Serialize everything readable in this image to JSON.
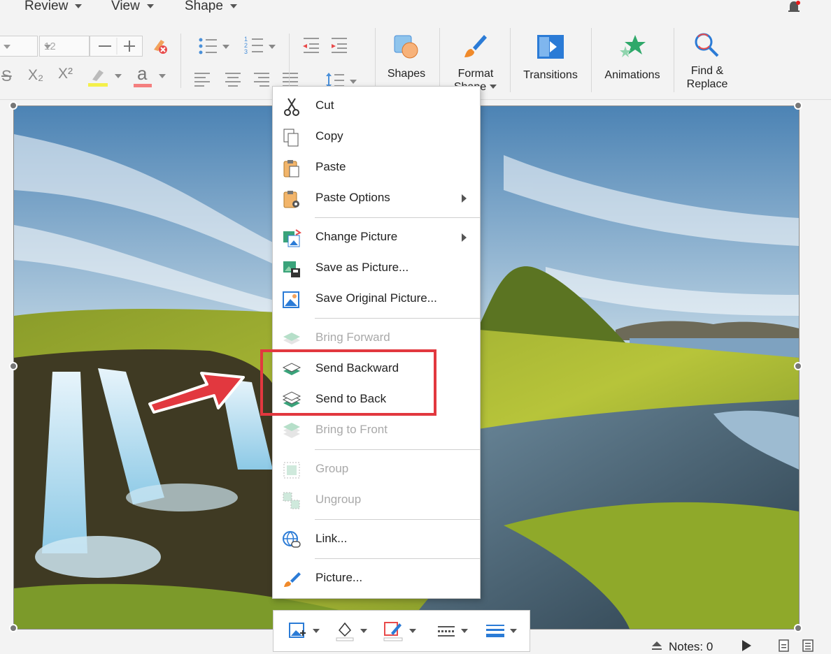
{
  "menubar": {
    "items": [
      {
        "label": "Review"
      },
      {
        "label": "View"
      },
      {
        "label": "Shape"
      }
    ]
  },
  "ribbon": {
    "font_size_value": "12",
    "shapes_label": "Shapes",
    "format_label_1": "Format",
    "format_label_2": "Shape",
    "transitions_label": "Transitions",
    "animations_label": "Animations",
    "find_label_1": "Find &",
    "find_label_2": "Replace",
    "superscript": "X²",
    "subscript": "X₂",
    "strike": "S",
    "font_color_letter": "a"
  },
  "context_menu": {
    "items": [
      {
        "label": "Cut",
        "icon": "scissors-icon",
        "enabled": true
      },
      {
        "label": "Copy",
        "icon": "copy-icon",
        "enabled": true
      },
      {
        "label": "Paste",
        "icon": "paste-icon",
        "enabled": true
      },
      {
        "label": "Paste Options",
        "icon": "paste-options-icon",
        "enabled": true,
        "submenu": true
      },
      {
        "label": "Change Picture",
        "icon": "change-picture-icon",
        "enabled": true,
        "submenu": true
      },
      {
        "label": "Save as Picture...",
        "icon": "save-as-picture-icon",
        "enabled": true
      },
      {
        "label": "Save Original Picture...",
        "icon": "picture-icon",
        "enabled": true
      },
      {
        "label": "Bring Forward",
        "icon": "bring-forward-icon",
        "enabled": false
      },
      {
        "label": "Send Backward",
        "icon": "send-backward-icon",
        "enabled": true
      },
      {
        "label": "Send to Back",
        "icon": "send-to-back-icon",
        "enabled": true
      },
      {
        "label": "Bring to Front",
        "icon": "bring-to-front-icon",
        "enabled": false
      },
      {
        "label": "Group",
        "icon": "group-icon",
        "enabled": false
      },
      {
        "label": "Ungroup",
        "icon": "ungroup-icon",
        "enabled": false
      },
      {
        "label": "Link...",
        "icon": "link-icon",
        "enabled": true
      },
      {
        "label": "Picture...",
        "icon": "format-brush-icon",
        "enabled": true
      }
    ]
  },
  "status_bar": {
    "notes": "Notes: 0"
  },
  "colors": {
    "highlight_border": "#e2383f",
    "arrow": "#e2383f",
    "layer_green": "#3aa37a",
    "accent_blue": "#2b7bd6"
  }
}
